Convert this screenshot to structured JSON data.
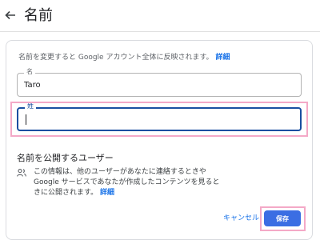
{
  "header": {
    "title": "名前"
  },
  "card": {
    "description": "名前を変更すると Google アカウント全体に反映されます。",
    "description_link": "詳細",
    "first_name": {
      "label": "名",
      "value": "Taro"
    },
    "last_name": {
      "label": "姓",
      "value": ""
    }
  },
  "visibility": {
    "title": "名前を公開するユーザー",
    "info_lines": [
      "この情報は、他のユーザーがあなたに連絡するときや",
      "Google サービスであなたが作成したコンテンツを見ると",
      "きに公開されます。"
    ],
    "info_link": "詳細"
  },
  "actions": {
    "cancel_label": "キャンセル",
    "save_label": "保存"
  },
  "colors": {
    "accent": "#1a73e8",
    "save_button": "#3b6ee3",
    "focus_border": "#1a4fa1",
    "highlight": "#f4a9c7"
  },
  "icons": {
    "back": "arrow-left-icon",
    "people": "people-icon"
  }
}
